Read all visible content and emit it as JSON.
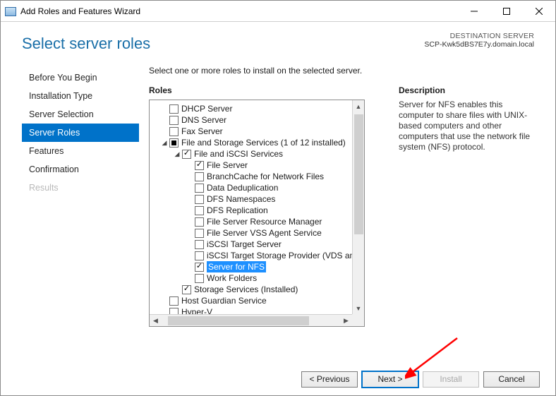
{
  "titlebar": {
    "title": "Add Roles and Features Wizard"
  },
  "header": {
    "page_title": "Select server roles",
    "dest_label": "DESTINATION SERVER",
    "dest_server": "SCP-Kwk5dBS7E7y.domain.local"
  },
  "nav": {
    "items": [
      {
        "label": "Before You Begin",
        "state": "normal"
      },
      {
        "label": "Installation Type",
        "state": "normal"
      },
      {
        "label": "Server Selection",
        "state": "normal"
      },
      {
        "label": "Server Roles",
        "state": "selected"
      },
      {
        "label": "Features",
        "state": "normal"
      },
      {
        "label": "Confirmation",
        "state": "normal"
      },
      {
        "label": "Results",
        "state": "disabled"
      }
    ]
  },
  "center": {
    "instruction": "Select one or more roles to install on the selected server.",
    "roles_label": "Roles",
    "roles": [
      {
        "indent": 0,
        "checkbox": "unchecked",
        "label": "DHCP Server"
      },
      {
        "indent": 0,
        "checkbox": "unchecked",
        "label": "DNS Server"
      },
      {
        "indent": 0,
        "checkbox": "unchecked",
        "label": "Fax Server"
      },
      {
        "indent": 0,
        "expander": "expanded",
        "checkbox": "indeterminate",
        "label": "File and Storage Services (1 of 12 installed)"
      },
      {
        "indent": 1,
        "expander": "expanded",
        "checkbox": "checked",
        "label": "File and iSCSI Services"
      },
      {
        "indent": 2,
        "checkbox": "checked",
        "label": "File Server"
      },
      {
        "indent": 2,
        "checkbox": "unchecked",
        "label": "BranchCache for Network Files"
      },
      {
        "indent": 2,
        "checkbox": "unchecked",
        "label": "Data Deduplication"
      },
      {
        "indent": 2,
        "checkbox": "unchecked",
        "label": "DFS Namespaces"
      },
      {
        "indent": 2,
        "checkbox": "unchecked",
        "label": "DFS Replication"
      },
      {
        "indent": 2,
        "checkbox": "unchecked",
        "label": "File Server Resource Manager"
      },
      {
        "indent": 2,
        "checkbox": "unchecked",
        "label": "File Server VSS Agent Service"
      },
      {
        "indent": 2,
        "checkbox": "unchecked",
        "label": "iSCSI Target Server"
      },
      {
        "indent": 2,
        "checkbox": "unchecked",
        "label": "iSCSI Target Storage Provider (VDS and VSS"
      },
      {
        "indent": 2,
        "checkbox": "checked",
        "label": "Server for NFS",
        "highlight": true
      },
      {
        "indent": 2,
        "checkbox": "unchecked",
        "label": "Work Folders"
      },
      {
        "indent": 1,
        "checkbox": "checked",
        "label": "Storage Services (Installed)"
      },
      {
        "indent": 0,
        "checkbox": "unchecked",
        "label": "Host Guardian Service"
      },
      {
        "indent": 0,
        "checkbox": "unchecked",
        "label": "Hyper-V"
      }
    ]
  },
  "description": {
    "heading": "Description",
    "text": "Server for NFS enables this computer to share files with UNIX-based computers and other computers that use the network file system (NFS) protocol."
  },
  "footer": {
    "previous": "< Previous",
    "next": "Next >",
    "install": "Install",
    "cancel": "Cancel"
  }
}
